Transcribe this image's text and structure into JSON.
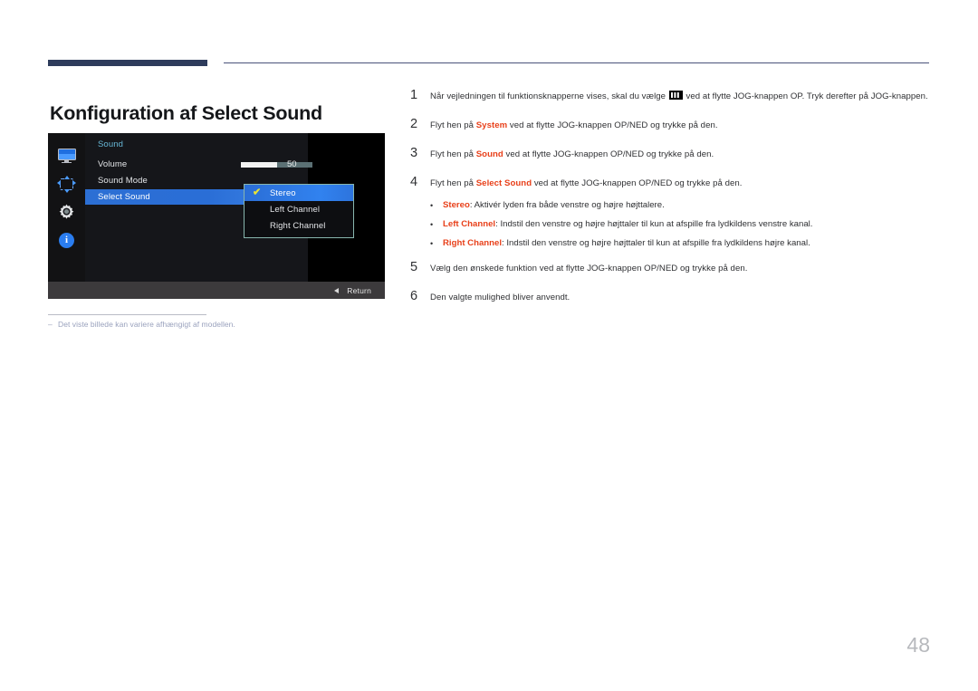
{
  "document": {
    "title": "Konfiguration af Select Sound",
    "page_number": "48"
  },
  "osd": {
    "menu_title": "Sound",
    "sidebar_icons": [
      {
        "name": "picture-icon",
        "label": "Picture"
      },
      {
        "name": "picture-size-icon",
        "label": "PIP/PBP"
      },
      {
        "name": "system-gear-icon",
        "label": "System"
      },
      {
        "name": "information-icon",
        "label": "Information"
      }
    ],
    "rows": [
      {
        "label": "Volume",
        "value": "50",
        "slider_percent": 50
      },
      {
        "label": "Sound Mode",
        "value": ""
      },
      {
        "label": "Select Sound",
        "value": "",
        "highlighted": true
      }
    ],
    "volume_label": "Volume",
    "volume_value": "50",
    "sound_mode_label": "Sound Mode",
    "select_sound_label": "Select Sound",
    "dropdown": {
      "items": [
        {
          "label": "Stereo",
          "selected": true
        },
        {
          "label": "Left Channel",
          "selected": false
        },
        {
          "label": "Right Channel",
          "selected": false
        }
      ],
      "check_glyph": "✔",
      "border_color": "#88b6ae"
    },
    "footer": {
      "return_label": "Return",
      "return_icon": "left-arrow-icon"
    },
    "colors": {
      "panel_bg": "#15161a",
      "sidebar_bg": "#121214",
      "highlight_blue": "#2c6fd4",
      "title_cyan": "#67b7d6",
      "check_yellow": "#e9e433"
    }
  },
  "footnote": {
    "dash": "‒",
    "text": "Det viste billede kan variere afhængigt af modellen."
  },
  "steps": [
    {
      "number": "1",
      "part1": "Når vejledningen til funktionsknapperne vises, skal du vælge ",
      "icon": "menu-grid-icon",
      "part2": " ved at flytte JOG-knappen OP. Tryk derefter på JOG-knappen."
    },
    {
      "number": "2",
      "part1": "Flyt hen på ",
      "bold": "System",
      "part2": " ved at flytte JOG-knappen OP/NED og trykke på den."
    },
    {
      "number": "3",
      "part1": "Flyt hen på ",
      "bold": "Sound",
      "part2": " ved at flytte JOG-knappen OP/NED og trykke på den."
    },
    {
      "number": "4",
      "part1": "Flyt hen på ",
      "bold": "Select Sound",
      "part2": " ved at flytte JOG-knappen OP/NED og trykke på den."
    },
    {
      "number": "5",
      "part1": "Vælg den ønskede funktion ved at flytte JOG-knappen OP/NED og trykke på den.",
      "bold": "",
      "part2": ""
    },
    {
      "number": "6",
      "part1": "Den valgte mulighed bliver anvendt.",
      "bold": "",
      "part2": ""
    }
  ],
  "bullets": {
    "dot": "•",
    "items": [
      {
        "bold": "Stereo",
        "text": ": Aktivér lyden fra både venstre og højre højttalere."
      },
      {
        "bold": "Left Channel",
        "text": ": Indstil den venstre og højre højttaler til kun at afspille fra lydkildens venstre kanal."
      },
      {
        "bold": "Right Channel",
        "text": ": Indstil den venstre og højre højttaler til kun at afspille fra lydkildens højre kanal."
      }
    ]
  },
  "accent_colors": {
    "brand_red": "#e8401a",
    "header_navy": "#2e3c5c",
    "footnote_gray": "#9aa2bd",
    "page_num_gray": "#b7b9bd"
  }
}
